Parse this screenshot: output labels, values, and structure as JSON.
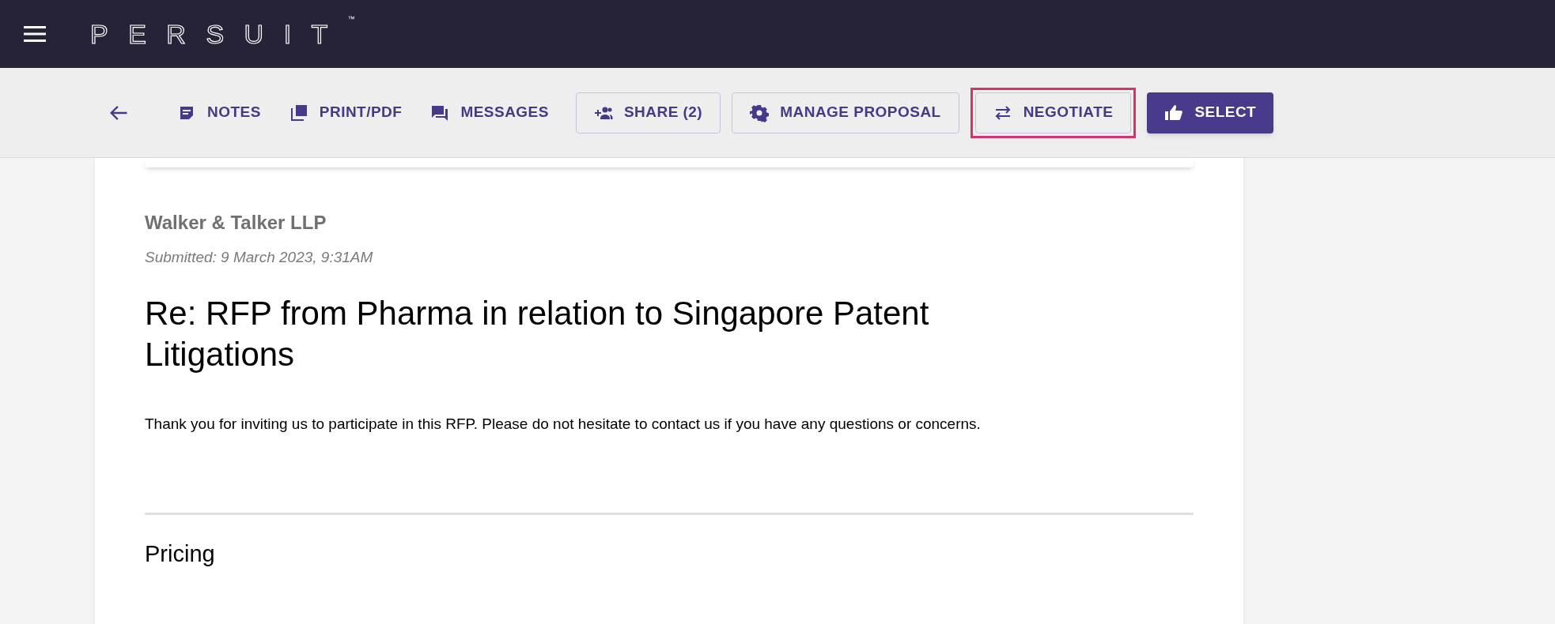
{
  "header": {
    "logo": "PERSUIT",
    "trademark": "™"
  },
  "toolbar": {
    "buttons": [
      {
        "kind": "text",
        "label": "NOTES",
        "highlighted": false
      },
      {
        "kind": "text",
        "label": "PRINT/PDF",
        "highlighted": false
      },
      {
        "kind": "text",
        "label": "MESSAGES",
        "highlighted": false
      },
      {
        "kind": "outlined",
        "label": "SHARE (2)",
        "highlighted": false
      },
      {
        "kind": "outlined",
        "label": "MANAGE PROPOSAL",
        "highlighted": false
      },
      {
        "kind": "outlined",
        "label": "NEGOTIATE",
        "highlighted": true
      },
      {
        "kind": "filled",
        "label": "SELECT",
        "highlighted": false
      }
    ]
  },
  "proposal": {
    "firm": "Walker & Talker LLP",
    "submitted": "Submitted: 9 March 2023, 9:31AM",
    "title": "Re: RFP from Pharma in relation to Singapore Patent Litigations",
    "message": "Thank you for inviting us to participate in this RFP. Please do not hesitate to contact us if you have any questions or concerns.",
    "section": "Pricing"
  }
}
